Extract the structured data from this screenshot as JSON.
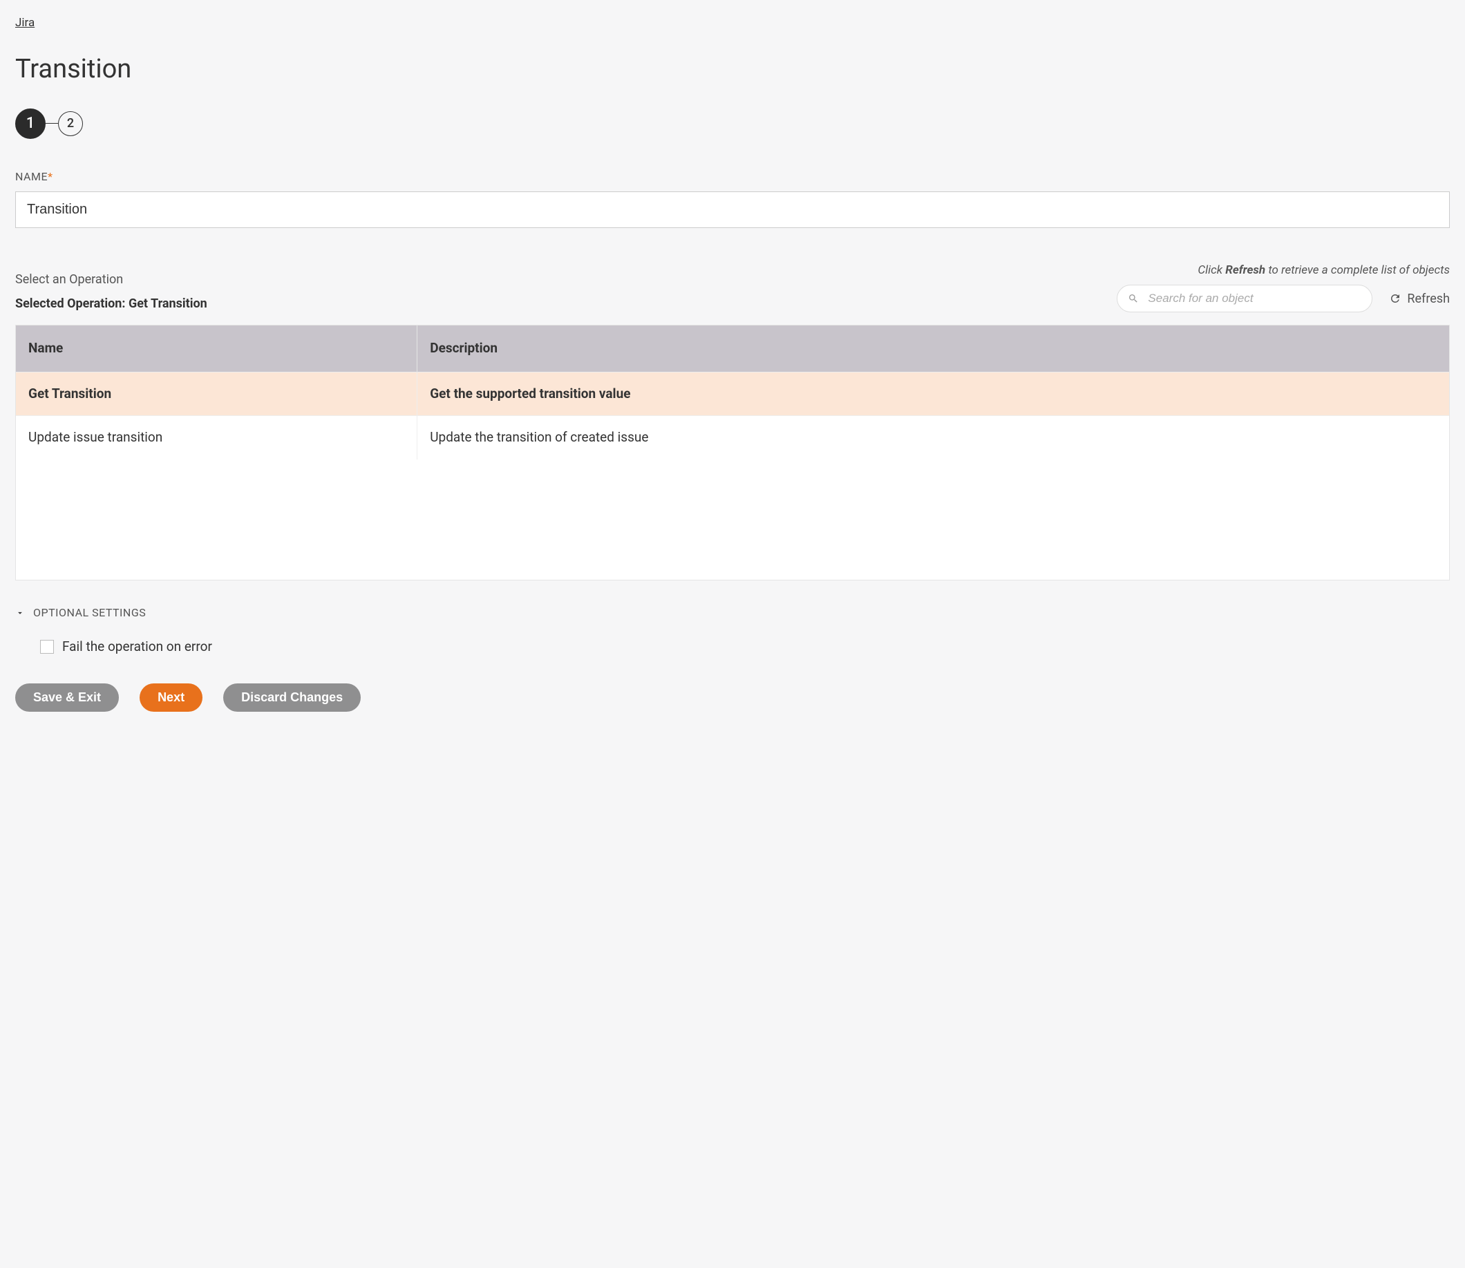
{
  "breadcrumb": "Jira",
  "page_title": "Transition",
  "stepper": {
    "step1": "1",
    "step2": "2"
  },
  "name_field": {
    "label": "NAME",
    "required_marker": "*",
    "value": "Transition"
  },
  "operations": {
    "select_label": "Select an Operation",
    "selected_prefix": "Selected Operation: ",
    "selected_value": "Get Transition",
    "refresh_hint_prefix": "Click ",
    "refresh_hint_strong": "Refresh",
    "refresh_hint_suffix": " to retrieve a complete list of objects",
    "search_placeholder": "Search for an object",
    "refresh_label": "Refresh",
    "columns": {
      "name": "Name",
      "description": "Description"
    },
    "rows": [
      {
        "name": "Get Transition",
        "description": "Get the supported transition value",
        "selected": true
      },
      {
        "name": "Update issue transition",
        "description": "Update the transition of created issue",
        "selected": false
      }
    ]
  },
  "optional": {
    "header": "OPTIONAL SETTINGS",
    "fail_on_error_label": "Fail the operation on error",
    "fail_on_error_checked": false
  },
  "buttons": {
    "save_exit": "Save & Exit",
    "next": "Next",
    "discard": "Discard Changes"
  }
}
